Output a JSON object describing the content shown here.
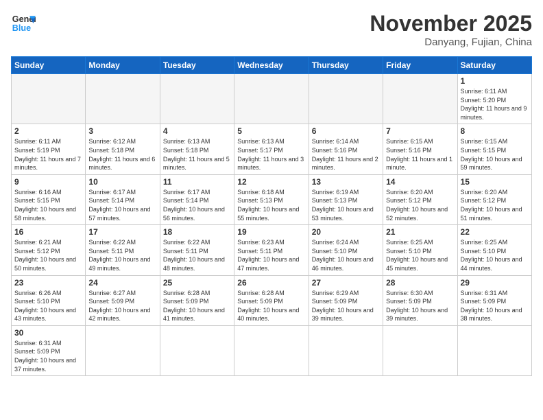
{
  "header": {
    "logo_general": "General",
    "logo_blue": "Blue",
    "month_title": "November 2025",
    "subtitle": "Danyang, Fujian, China"
  },
  "weekdays": [
    "Sunday",
    "Monday",
    "Tuesday",
    "Wednesday",
    "Thursday",
    "Friday",
    "Saturday"
  ],
  "days": [
    {
      "date": "",
      "empty": true
    },
    {
      "date": "",
      "empty": true
    },
    {
      "date": "",
      "empty": true
    },
    {
      "date": "",
      "empty": true
    },
    {
      "date": "",
      "empty": true
    },
    {
      "date": "",
      "empty": true
    },
    {
      "date": "1",
      "sunrise": "6:11 AM",
      "sunset": "5:20 PM",
      "daylight": "11 hours and 9 minutes."
    },
    {
      "date": "2",
      "sunrise": "6:11 AM",
      "sunset": "5:19 PM",
      "daylight": "11 hours and 7 minutes."
    },
    {
      "date": "3",
      "sunrise": "6:12 AM",
      "sunset": "5:18 PM",
      "daylight": "11 hours and 6 minutes."
    },
    {
      "date": "4",
      "sunrise": "6:13 AM",
      "sunset": "5:18 PM",
      "daylight": "11 hours and 5 minutes."
    },
    {
      "date": "5",
      "sunrise": "6:13 AM",
      "sunset": "5:17 PM",
      "daylight": "11 hours and 3 minutes."
    },
    {
      "date": "6",
      "sunrise": "6:14 AM",
      "sunset": "5:16 PM",
      "daylight": "11 hours and 2 minutes."
    },
    {
      "date": "7",
      "sunrise": "6:15 AM",
      "sunset": "5:16 PM",
      "daylight": "11 hours and 1 minute."
    },
    {
      "date": "8",
      "sunrise": "6:15 AM",
      "sunset": "5:15 PM",
      "daylight": "10 hours and 59 minutes."
    },
    {
      "date": "9",
      "sunrise": "6:16 AM",
      "sunset": "5:15 PM",
      "daylight": "10 hours and 58 minutes."
    },
    {
      "date": "10",
      "sunrise": "6:17 AM",
      "sunset": "5:14 PM",
      "daylight": "10 hours and 57 minutes."
    },
    {
      "date": "11",
      "sunrise": "6:17 AM",
      "sunset": "5:14 PM",
      "daylight": "10 hours and 56 minutes."
    },
    {
      "date": "12",
      "sunrise": "6:18 AM",
      "sunset": "5:13 PM",
      "daylight": "10 hours and 55 minutes."
    },
    {
      "date": "13",
      "sunrise": "6:19 AM",
      "sunset": "5:13 PM",
      "daylight": "10 hours and 53 minutes."
    },
    {
      "date": "14",
      "sunrise": "6:20 AM",
      "sunset": "5:12 PM",
      "daylight": "10 hours and 52 minutes."
    },
    {
      "date": "15",
      "sunrise": "6:20 AM",
      "sunset": "5:12 PM",
      "daylight": "10 hours and 51 minutes."
    },
    {
      "date": "16",
      "sunrise": "6:21 AM",
      "sunset": "5:12 PM",
      "daylight": "10 hours and 50 minutes."
    },
    {
      "date": "17",
      "sunrise": "6:22 AM",
      "sunset": "5:11 PM",
      "daylight": "10 hours and 49 minutes."
    },
    {
      "date": "18",
      "sunrise": "6:22 AM",
      "sunset": "5:11 PM",
      "daylight": "10 hours and 48 minutes."
    },
    {
      "date": "19",
      "sunrise": "6:23 AM",
      "sunset": "5:11 PM",
      "daylight": "10 hours and 47 minutes."
    },
    {
      "date": "20",
      "sunrise": "6:24 AM",
      "sunset": "5:10 PM",
      "daylight": "10 hours and 46 minutes."
    },
    {
      "date": "21",
      "sunrise": "6:25 AM",
      "sunset": "5:10 PM",
      "daylight": "10 hours and 45 minutes."
    },
    {
      "date": "22",
      "sunrise": "6:25 AM",
      "sunset": "5:10 PM",
      "daylight": "10 hours and 44 minutes."
    },
    {
      "date": "23",
      "sunrise": "6:26 AM",
      "sunset": "5:10 PM",
      "daylight": "10 hours and 43 minutes."
    },
    {
      "date": "24",
      "sunrise": "6:27 AM",
      "sunset": "5:09 PM",
      "daylight": "10 hours and 42 minutes."
    },
    {
      "date": "25",
      "sunrise": "6:28 AM",
      "sunset": "5:09 PM",
      "daylight": "10 hours and 41 minutes."
    },
    {
      "date": "26",
      "sunrise": "6:28 AM",
      "sunset": "5:09 PM",
      "daylight": "10 hours and 40 minutes."
    },
    {
      "date": "27",
      "sunrise": "6:29 AM",
      "sunset": "5:09 PM",
      "daylight": "10 hours and 39 minutes."
    },
    {
      "date": "28",
      "sunrise": "6:30 AM",
      "sunset": "5:09 PM",
      "daylight": "10 hours and 39 minutes."
    },
    {
      "date": "29",
      "sunrise": "6:31 AM",
      "sunset": "5:09 PM",
      "daylight": "10 hours and 38 minutes."
    },
    {
      "date": "30",
      "sunrise": "6:31 AM",
      "sunset": "5:09 PM",
      "daylight": "10 hours and 37 minutes."
    }
  ],
  "labels": {
    "sunrise": "Sunrise:",
    "sunset": "Sunset:",
    "daylight": "Daylight:"
  }
}
